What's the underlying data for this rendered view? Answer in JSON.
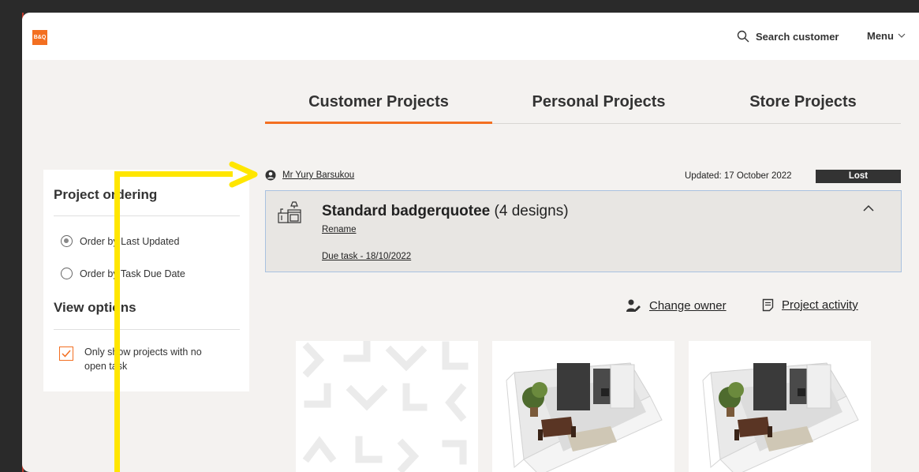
{
  "header": {
    "logo_text": "B&Q",
    "search_label": "Search customer",
    "menu_label": "Menu"
  },
  "tabs": [
    {
      "label": "Customer Projects",
      "active": true
    },
    {
      "label": "Personal Projects",
      "active": false
    },
    {
      "label": "Store Projects",
      "active": false
    }
  ],
  "sidebar": {
    "ordering_title": "Project ordering",
    "ordering_options": [
      {
        "label": "Order by Last Updated",
        "selected": true
      },
      {
        "label": "Order by Task Due Date",
        "selected": false
      }
    ],
    "view_title": "View options",
    "view_option": {
      "label": "Only show projects with no open task",
      "checked": true
    }
  },
  "project": {
    "owner": "Mr Yury Barsukou",
    "updated": "Updated: 17 October 2022",
    "status": "Lost",
    "title": "Standard badgerquotee",
    "designs": "(4 designs)",
    "rename": "Rename",
    "due_task": "Due task - 18/10/2022",
    "change_owner": "Change owner",
    "project_activity": "Project activity"
  },
  "colors": {
    "brand": "#f36f21",
    "annotation": "#ffe600",
    "status_bg": "#333333"
  }
}
